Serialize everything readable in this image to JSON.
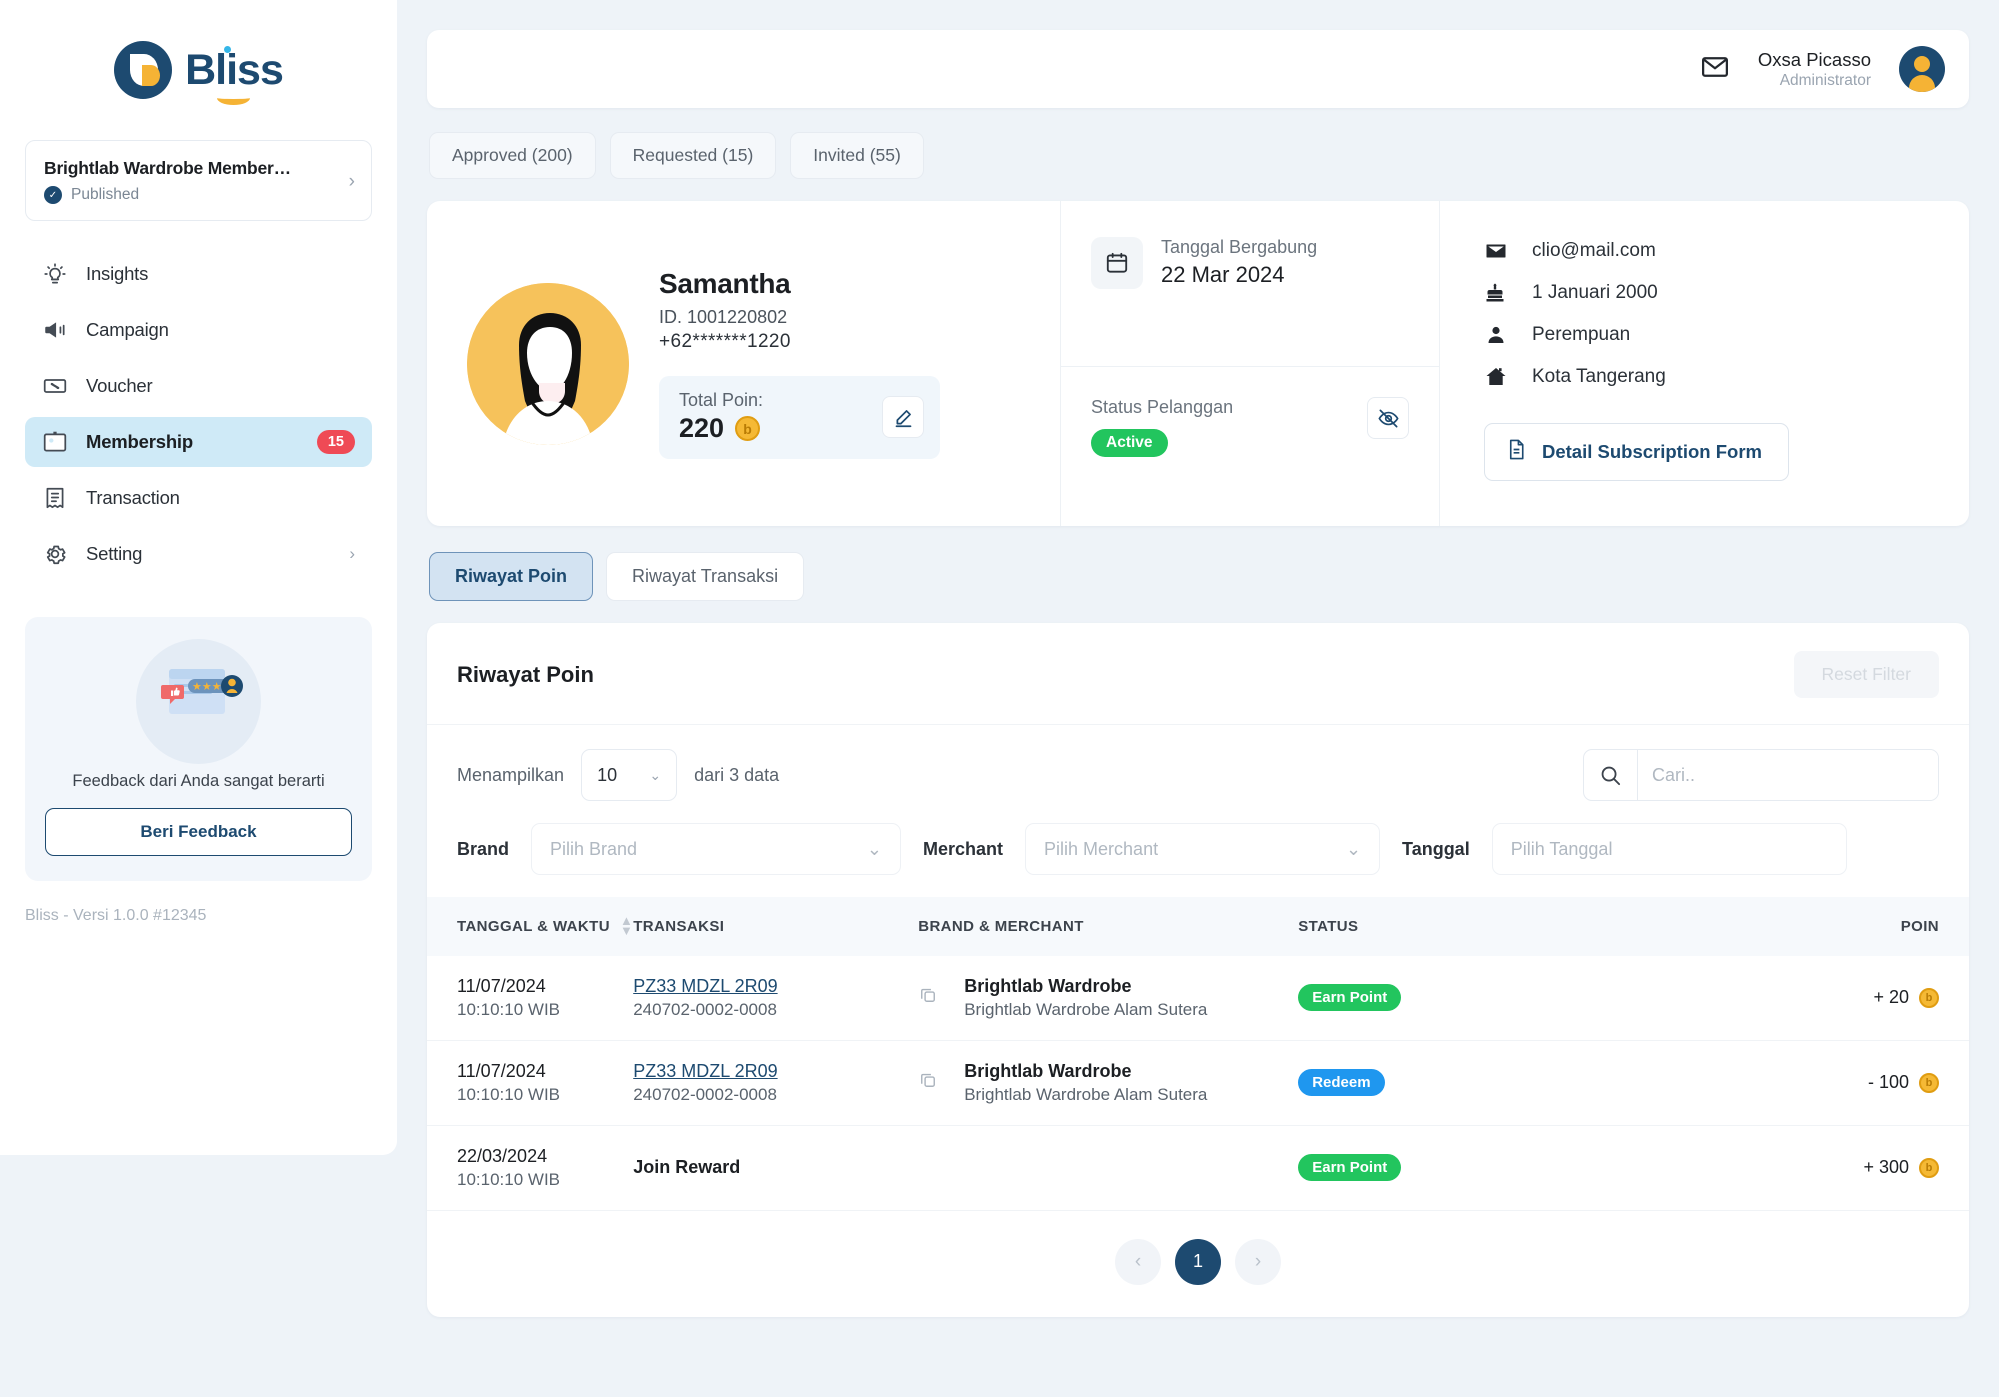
{
  "brand": {
    "name": "Bliss",
    "version": "Bliss - Versi 1.0.0 #12345"
  },
  "workspace": {
    "title": "Brightlab Wardrobe Member…",
    "status": "Published"
  },
  "sidebar": {
    "items": [
      {
        "label": "Insights",
        "icon": "insights-icon",
        "badge": null
      },
      {
        "label": "Campaign",
        "icon": "megaphone-icon",
        "badge": null
      },
      {
        "label": "Voucher",
        "icon": "voucher-icon",
        "badge": null
      },
      {
        "label": "Membership",
        "icon": "id-card-icon",
        "badge": "15"
      },
      {
        "label": "Transaction",
        "icon": "receipt-icon",
        "badge": null
      },
      {
        "label": "Setting",
        "icon": "gear-icon",
        "badge": null
      }
    ]
  },
  "feedback": {
    "text": "Feedback dari Anda sangat berarti",
    "button": "Beri Feedback"
  },
  "topbar": {
    "user_name": "Oxsa Picasso",
    "user_role": "Administrator"
  },
  "status_tabs": [
    {
      "label": "Approved (200)"
    },
    {
      "label": "Requested (15)"
    },
    {
      "label": "Invited (55)"
    }
  ],
  "profile": {
    "name": "Samantha",
    "id": "ID. 1001220802",
    "phone": "+62*******1220",
    "points_label": "Total Poin:",
    "points_value": "220",
    "join_label": "Tanggal Bergabung",
    "join_date": "22 Mar 2024",
    "status_label": "Status Pelanggan",
    "status_value": "Active",
    "email": "clio@mail.com",
    "birthdate": "1 Januari 2000",
    "gender": "Perempuan",
    "city": "Kota Tangerang",
    "detail_button": "Detail Subscription Form"
  },
  "history_tabs": [
    {
      "label": "Riwayat Poin",
      "active": true
    },
    {
      "label": "Riwayat Transaksi",
      "active": false
    }
  ],
  "table_card": {
    "title": "Riwayat Poin",
    "reset_label": "Reset Filter",
    "show_label": "Menampilkan",
    "show_value": "10",
    "count_label": "dari 3 data",
    "search_placeholder": "Cari..",
    "brand_label": "Brand",
    "brand_placeholder": "Pilih Brand",
    "merchant_label": "Merchant",
    "merchant_placeholder": "Pilih Merchant",
    "tanggal_label": "Tanggal",
    "tanggal_placeholder": "Pilih Tanggal",
    "columns": [
      "TANGGAL & WAKTU",
      "TRANSAKSI",
      "BRAND & MERCHANT",
      "STATUS",
      "POIN"
    ],
    "rows": [
      {
        "date": "11/07/2024",
        "time": "10:10:10 WIB",
        "trx_code": "PZ33 MDZL 2R09",
        "trx_ref": "240702-0002-0008",
        "trx_link": true,
        "brand": "Brightlab Wardrobe",
        "merchant": "Brightlab Wardrobe Alam Sutera",
        "status": "Earn Point",
        "status_kind": "earn",
        "poin": "+ 20"
      },
      {
        "date": "11/07/2024",
        "time": "10:10:10 WIB",
        "trx_code": "PZ33 MDZL 2R09",
        "trx_ref": "240702-0002-0008",
        "trx_link": true,
        "brand": "Brightlab Wardrobe",
        "merchant": "Brightlab Wardrobe Alam Sutera",
        "status": "Redeem",
        "status_kind": "redeem",
        "poin": "- 100"
      },
      {
        "date": "22/03/2024",
        "time": "10:10:10 WIB",
        "trx_code": "Join Reward",
        "trx_ref": "",
        "trx_link": false,
        "brand": "",
        "merchant": "",
        "status": "Earn Point",
        "status_kind": "earn",
        "poin": "+ 300"
      }
    ],
    "pagination": {
      "prev": "‹",
      "current": "1",
      "next": "›"
    }
  },
  "colors": {
    "brand_navy": "#1d4a70",
    "accent_yellow": "#f5b335",
    "badge_red": "#ef4a55",
    "status_green": "#22c55e",
    "status_blue": "#1f97ef",
    "page_bg": "#eef3f8"
  }
}
